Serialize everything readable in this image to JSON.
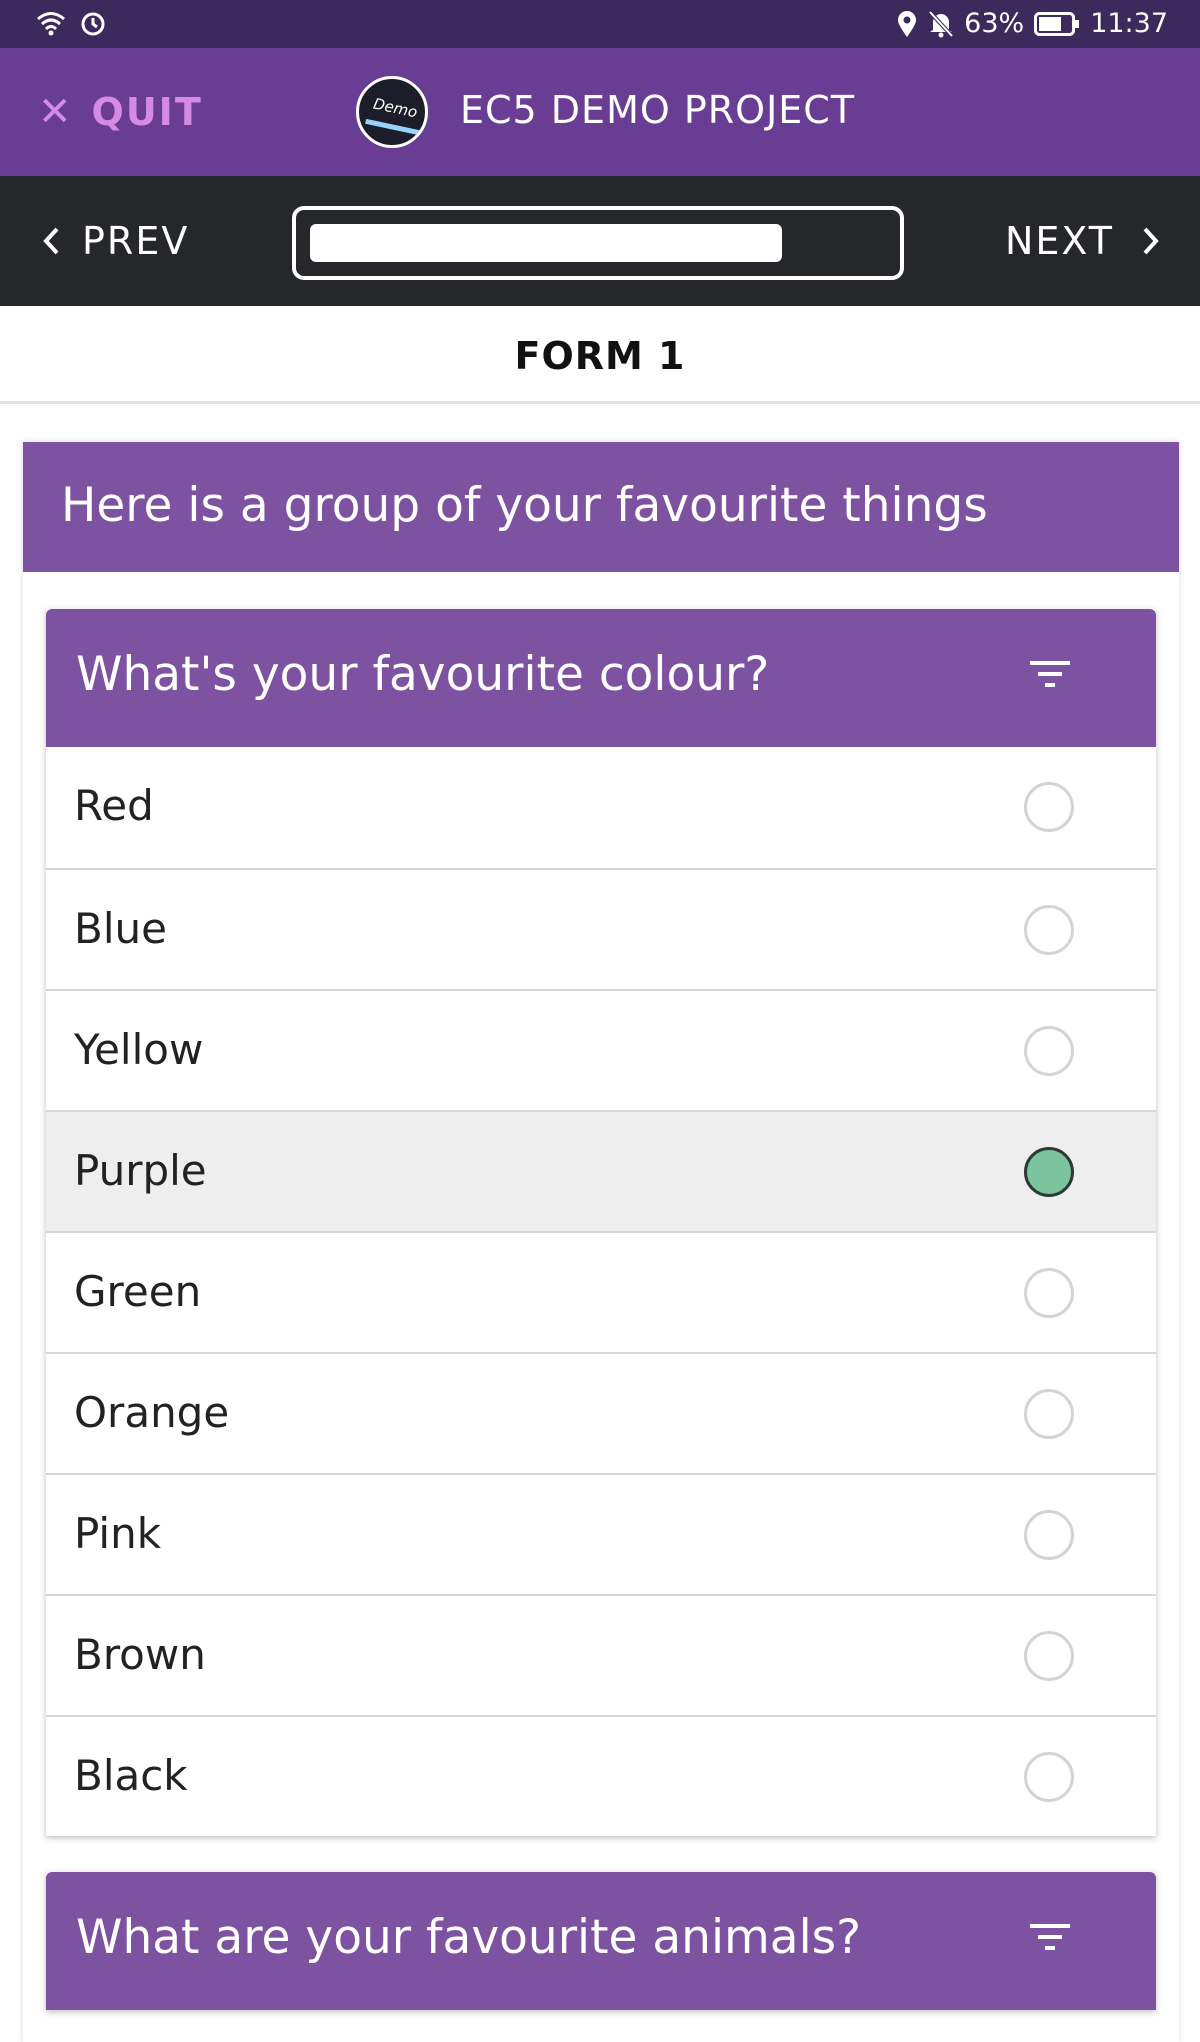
{
  "status_bar": {
    "battery": "63%",
    "time": "11:37"
  },
  "header": {
    "quit_label": "QUIT",
    "logo_text": "Demo",
    "project_title": "EC5 DEMO PROJECT"
  },
  "nav": {
    "prev_label": "PREV",
    "next_label": "NEXT",
    "progress": 0.82
  },
  "form": {
    "title": "FORM 1"
  },
  "group": {
    "title": "Here is a group of your favourite things",
    "questions": [
      {
        "title": "What's your favourite colour?",
        "options": [
          "Red",
          "Blue",
          "Yellow",
          "Purple",
          "Green",
          "Orange",
          "Pink",
          "Brown",
          "Black"
        ],
        "selected": "Purple"
      },
      {
        "title": "What are your favourite animals?"
      }
    ]
  },
  "colors": {
    "status_bar": "#3c2a5c",
    "header": "#6a3d94",
    "quit": "#d58ae6",
    "nav_bar": "#25272b",
    "group_header": "#7d52a1",
    "selected_radio": "#7cc49e"
  },
  "icons": {
    "wifi": "wifi-icon",
    "alarm": "alarm-icon",
    "location": "location-icon",
    "bell_off": "bell-off-icon",
    "battery": "battery-icon",
    "quit": "close-icon",
    "prev": "chevron-left-icon",
    "next": "chevron-right-icon",
    "filter": "filter-icon"
  }
}
